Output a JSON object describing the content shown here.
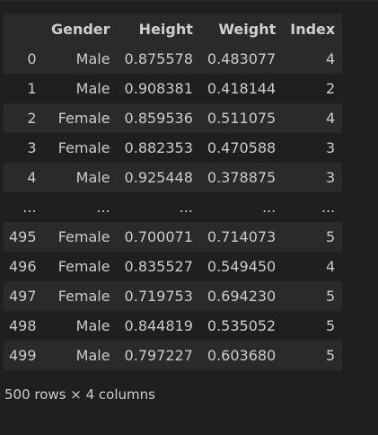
{
  "dataframe": {
    "columns": [
      "",
      "Gender",
      "Height",
      "Weight",
      "Index"
    ],
    "rows": [
      [
        "0",
        "Male",
        "0.875578",
        "0.483077",
        "4"
      ],
      [
        "1",
        "Male",
        "0.908381",
        "0.418144",
        "2"
      ],
      [
        "2",
        "Female",
        "0.859536",
        "0.511075",
        "4"
      ],
      [
        "3",
        "Female",
        "0.882353",
        "0.470588",
        "3"
      ],
      [
        "4",
        "Male",
        "0.925448",
        "0.378875",
        "3"
      ],
      [
        "...",
        "...",
        "...",
        "...",
        "..."
      ],
      [
        "495",
        "Female",
        "0.700071",
        "0.714073",
        "5"
      ],
      [
        "496",
        "Female",
        "0.835527",
        "0.549450",
        "4"
      ],
      [
        "497",
        "Female",
        "0.719753",
        "0.694230",
        "5"
      ],
      [
        "498",
        "Male",
        "0.844819",
        "0.535052",
        "5"
      ],
      [
        "499",
        "Male",
        "0.797227",
        "0.603680",
        "5"
      ]
    ],
    "summary": "500 rows × 4 columns"
  }
}
